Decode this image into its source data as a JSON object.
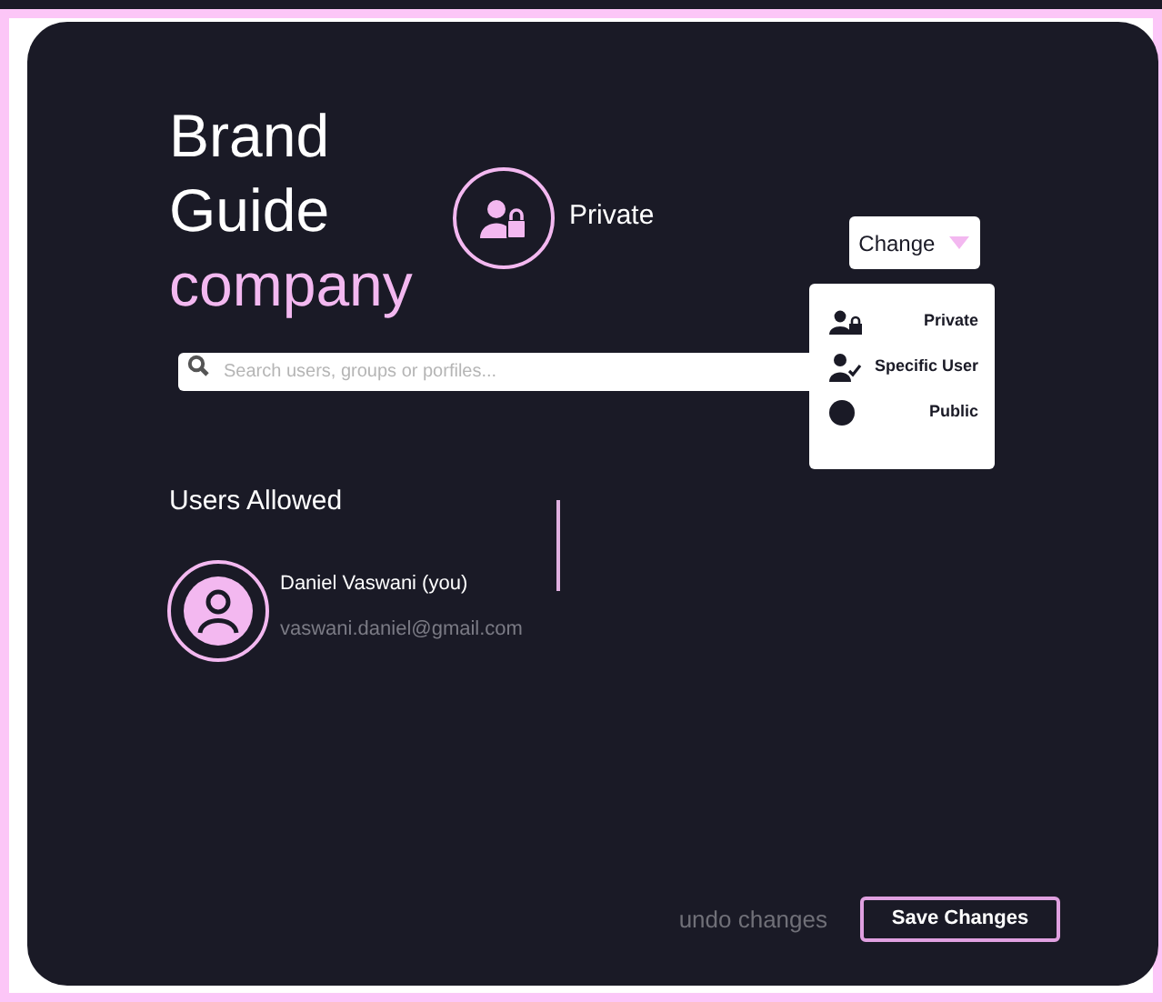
{
  "title": {
    "line_1": "Brand",
    "line_2": "Guide",
    "line_3": "company"
  },
  "visibility": {
    "label": "Private"
  },
  "change_button": {
    "label": "Change"
  },
  "menu": [
    {
      "kind": "private",
      "label": "Private"
    },
    {
      "kind": "specific",
      "label": "Specific User"
    },
    {
      "kind": "public",
      "label": "Public"
    }
  ],
  "search": {
    "placeholder": "Search users, groups or porfiles..."
  },
  "users_heading": "Users Allowed",
  "users": [
    {
      "name": "Daniel Vaswani (you)",
      "email": "vaswani.daniel@gmail.com"
    }
  ],
  "undo": "undo changes",
  "save": "Save Changes"
}
